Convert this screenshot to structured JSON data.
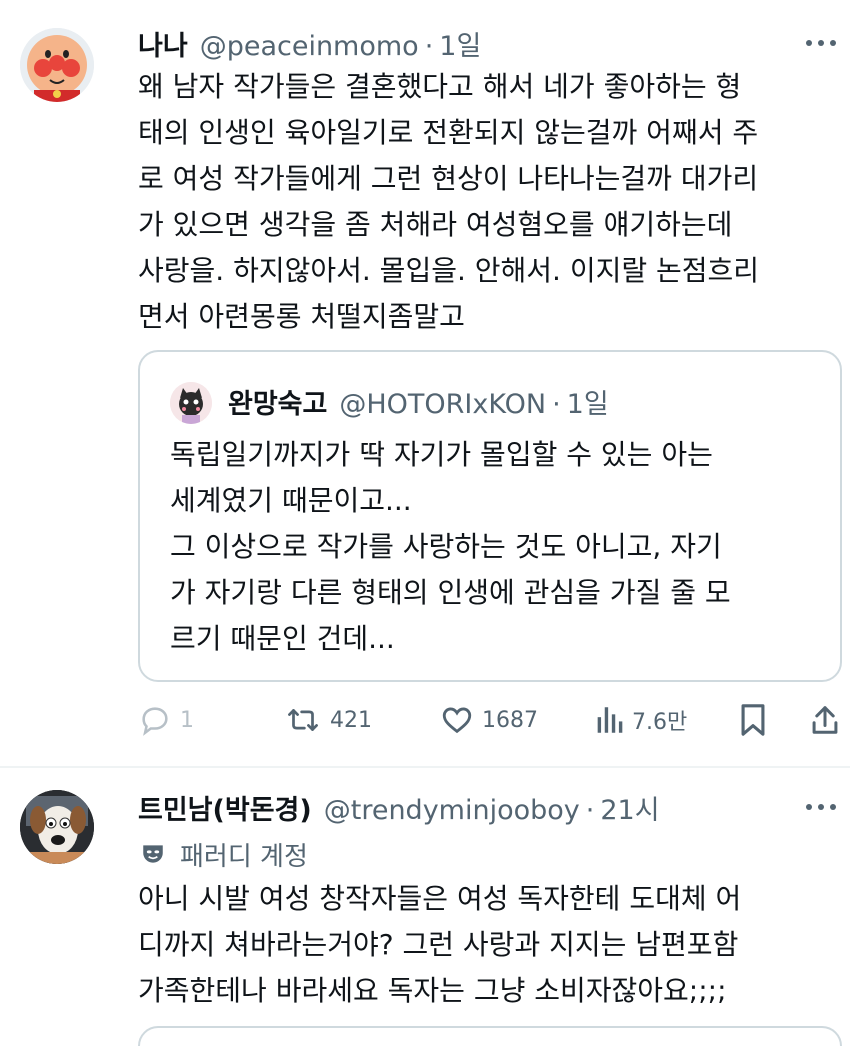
{
  "tweets": [
    {
      "name": "나나",
      "handle": "@peaceinmomo",
      "dot": "·",
      "time": "1일",
      "body": "왜 남자 작가들은 결혼했다고 해서 네가 좋아하는 형\n태의 인생인 육아일기로 전환되지 않는걸까 어째서 주\n로 여성 작가들에게 그런 현상이 나타나는걸까 대가리\n가 있으면 생각을 좀 처해라 여성혐오를 얘기하는데\n사랑을. 하지않아서. 몰입을. 안해서. 이지랄 논점흐리\n면서 아련몽롱 처떨지좀말고",
      "quote": {
        "name": "완망숙고",
        "handle": "@HOTORIxKON",
        "dot": "·",
        "time": "1일",
        "body": "독립일기까지가 딱 자기가 몰입할 수 있는 아는\n세계였기 때문이고...\n그 이상으로 작가를 사랑하는 것도 아니고, 자기\n가 자기랑 다른 형태의 인생에 관심을 가질 줄 모\n르기 때문인 건데..."
      },
      "actions": {
        "reply_icon": "reply-icon",
        "reply_count": "1",
        "retweet_icon": "retweet-icon",
        "retweet_count": "421",
        "like_icon": "heart-icon",
        "like_count": "1687",
        "views_icon": "views-icon",
        "views_count": "7.6만",
        "bookmark_icon": "bookmark-icon",
        "share_icon": "share-icon"
      }
    },
    {
      "name": "트민남(박돈경)",
      "handle": "@trendyminjooboy",
      "dot": "·",
      "time": "21시",
      "label": "패러디 계정",
      "label_icon": "parody-mask-icon",
      "body": "아니 시발 여성 창작자들은 여성 독자한테 도대체 어\n디까지 쳐바라는거야? 그런 사랑과 지지는 남편포함\n가족한테나 바라세요 독자는 그냥 소비자잖아요;;;;"
    }
  ],
  "colors": {
    "text": "#0f1419",
    "secondary": "#536471",
    "border": "#cfd9de",
    "divider": "#eff3f4"
  }
}
